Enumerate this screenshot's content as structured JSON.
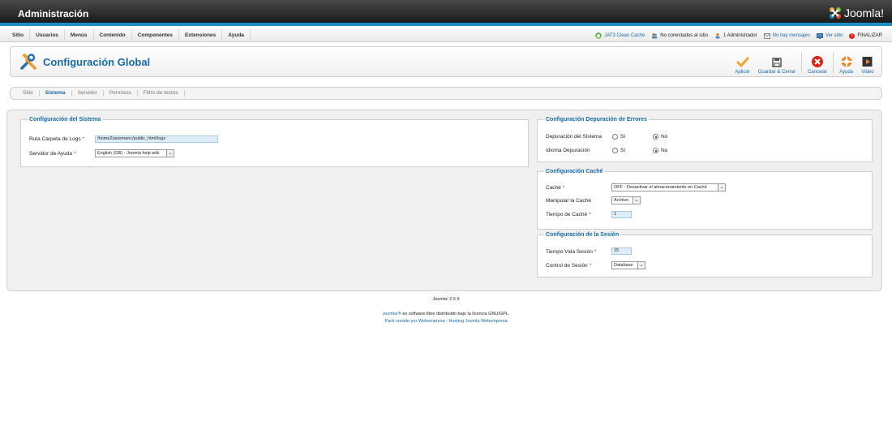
{
  "header": {
    "title": "Administración",
    "logo_text": "Joomla!"
  },
  "menu": {
    "items": [
      "Sitio",
      "Usuarios",
      "Menús",
      "Contenido",
      "Componentes",
      "Extensiones",
      "Ayuda"
    ]
  },
  "status": {
    "cache": "JAT3 Clean Cache",
    "visitors": "No conectados al sitio",
    "admins": "1 Administrador",
    "messages": "No hay mensajes",
    "view_site": "Ver sitio",
    "logout": "FINALIZAR"
  },
  "toolbar": {
    "page_title": "Configuración Global",
    "apply": "Aplicar",
    "save_close": "Guardar & Cerrar",
    "cancel": "Cancelar",
    "help": "Ayuda",
    "video": "Video"
  },
  "subtabs": [
    "Sitio",
    "Sistema",
    "Servidor",
    "Permisos",
    "Filtro de textos"
  ],
  "system": {
    "legend": "Configuración del Sistema",
    "log_path_label": "Ruta Carpeta de Logs",
    "log_path_value": "/home2/asismanc/public_html/logs",
    "help_server_label": "Servidor de Ayuda",
    "help_server_value": "English (GB) - Joomla help wiki"
  },
  "debug": {
    "legend": "Configuración Depuración de Errores",
    "system_debug_label": "Depuración del Sistema",
    "lang_debug_label": "Idioma Depuración",
    "yes": "Sí",
    "no": "No"
  },
  "cache": {
    "legend": "Configuración Caché",
    "cache_label": "Caché",
    "cache_value": "OFF - Desactivar el almacenamiento en Caché",
    "handler_label": "Manipular la Caché",
    "handler_value": "Archivo",
    "time_label": "Tiempo de Caché",
    "time_value": "1"
  },
  "session": {
    "legend": "Configuración de la Sesión",
    "lifetime_label": "Tiempo Vida Sesión",
    "lifetime_value": "15",
    "handler_label": "Control de Sesión",
    "handler_value": "Database"
  },
  "footer": {
    "version": "Joomla! 2.5.9",
    "license_link": "Joomla!®",
    "license_text": " es software libre distribuido bajo la licencia GNU/GPL.",
    "pack_link": "Pack creado por Webempresa",
    "sep": " - ",
    "hosting_link": "Hosting Joomla Webempresa"
  },
  "colors": {
    "accent": "#146aa7",
    "header_stripe": "#1c8fc9",
    "required": "#d9231b"
  }
}
